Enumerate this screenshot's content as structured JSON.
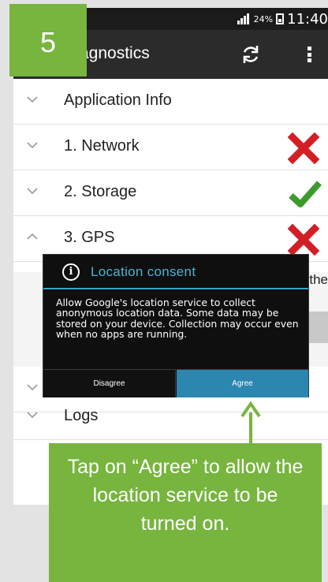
{
  "step_number": "5",
  "status_bar": {
    "battery_percent": "24%",
    "time": "11:40"
  },
  "action_bar": {
    "title": "agnostics",
    "refresh_icon": "refresh-icon",
    "overflow_icon": "overflow-menu-icon"
  },
  "rows": [
    {
      "label": "Application Info",
      "expanded": false,
      "status": "none"
    },
    {
      "label": "1. Network",
      "expanded": false,
      "status": "fail"
    },
    {
      "label": "2. Storage",
      "expanded": false,
      "status": "pass"
    },
    {
      "label": "3. GPS",
      "expanded": true,
      "status": "fail"
    },
    {
      "label": "Logs",
      "expanded": false,
      "status": "none"
    }
  ],
  "gps_detail_text": "the",
  "dialog": {
    "title": "Location consent",
    "body": "Allow Google's location service to collect anonymous location data. Some data may be stored on your device. Collection may occur even when no apps are running.",
    "disagree_label": "Disagree",
    "agree_label": "Agree"
  },
  "callout_text": "Tap on “Agree” to allow the location service to be turned on.",
  "colors": {
    "accent_green": "#77b53e",
    "fail_red": "#d21f26",
    "pass_green": "#3d9a2c",
    "dialog_blue": "#2b86b0",
    "dialog_title_blue": "#4cb3d8"
  }
}
